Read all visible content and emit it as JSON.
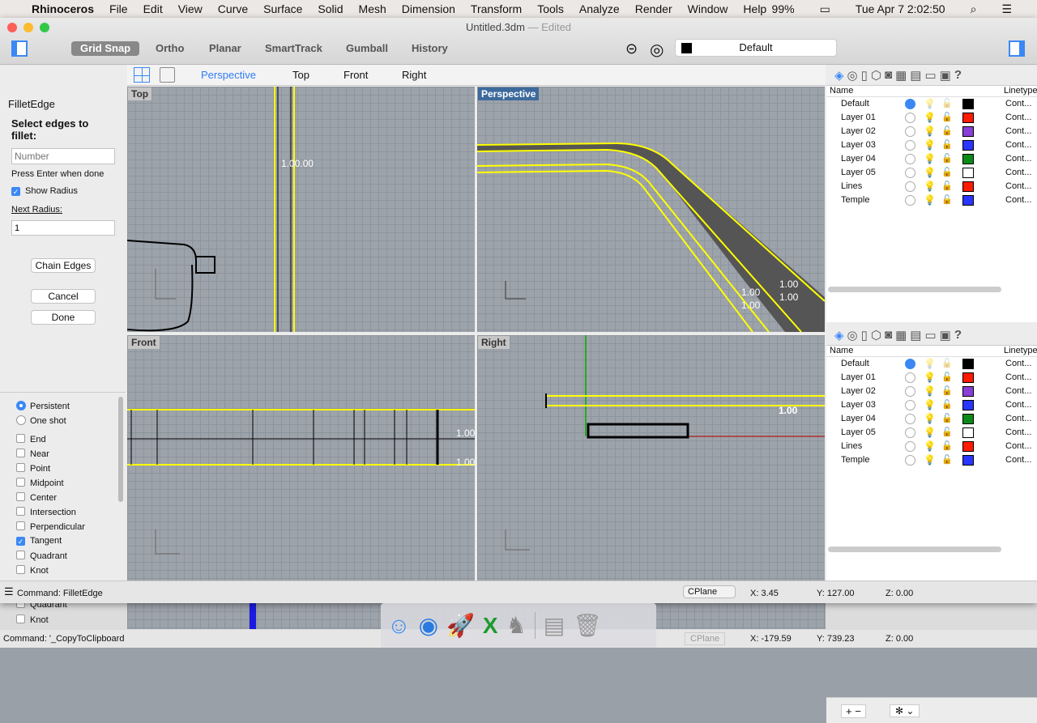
{
  "menubar": {
    "app": "Rhinoceros",
    "items": [
      "File",
      "Edit",
      "View",
      "Curve",
      "Surface",
      "Solid",
      "Mesh",
      "Dimension",
      "Transform",
      "Tools",
      "Analyze",
      "Render",
      "Window",
      "Help"
    ],
    "battery": "99%",
    "clock": "Tue Apr 7  2:02:50"
  },
  "window": {
    "title": "Untitled.3dm",
    "status": "Edited"
  },
  "toolbar": {
    "buttons": [
      "Grid Snap",
      "Ortho",
      "Planar",
      "SmartTrack",
      "Gumball",
      "History"
    ],
    "layer": "Default"
  },
  "viewport_tabs": [
    "Perspective",
    "Top",
    "Front",
    "Right"
  ],
  "viewports": {
    "top": "Top",
    "perspective": "Perspective",
    "front": "Front",
    "right": "Right"
  },
  "dims": {
    "top": "1.00.00",
    "persp": [
      "1.00",
      "1.00",
      "1.00",
      "1.00"
    ],
    "front": [
      "1.00",
      "1.00"
    ],
    "right": "1.00"
  },
  "command_panel": {
    "title": "FilletEdge",
    "prompt": "Select edges to fillet:",
    "number_placeholder": "Number",
    "hint": "Press Enter when done",
    "show_radius": "Show Radius",
    "next_radius_label": "Next Radius:",
    "next_radius": "1",
    "chain": "Chain Edges",
    "cancel": "Cancel",
    "done": "Done"
  },
  "osnap": {
    "modes": [
      "Persistent",
      "One shot"
    ],
    "items": [
      {
        "label": "End",
        "checked": false
      },
      {
        "label": "Near",
        "checked": false
      },
      {
        "label": "Point",
        "checked": false
      },
      {
        "label": "Midpoint",
        "checked": false
      },
      {
        "label": "Center",
        "checked": false
      },
      {
        "label": "Intersection",
        "checked": false
      },
      {
        "label": "Perpendicular",
        "checked": false
      },
      {
        "label": "Tangent",
        "checked": true
      },
      {
        "label": "Quadrant",
        "checked": false
      },
      {
        "label": "Knot",
        "checked": false
      }
    ]
  },
  "layers": {
    "col_name": "Name",
    "col_linetype": "Linetype",
    "rows": [
      {
        "name": "Default",
        "color": "#000000",
        "current": true
      },
      {
        "name": "Layer 01",
        "color": "#ff1a00"
      },
      {
        "name": "Layer 02",
        "color": "#8a3fd6"
      },
      {
        "name": "Layer 03",
        "color": "#2a35ff"
      },
      {
        "name": "Layer 04",
        "color": "#0a8a18"
      },
      {
        "name": "Layer 05",
        "color": "#ffffff"
      },
      {
        "name": "Lines",
        "color": "#ff1a00"
      },
      {
        "name": "Temple",
        "color": "#2a35ff"
      }
    ],
    "linetype": "Cont..."
  },
  "statusbar": {
    "command": "Command: FilletEdge",
    "cplane": "CPlane",
    "x": "X: 3.45",
    "y": "Y: 127.00",
    "z": "Z: 0.00"
  },
  "background": {
    "command": "Command: '_CopyToClipboard",
    "cplane": "CPlane",
    "x": "X: -179.59",
    "y": "Y: 739.23",
    "z": "Z: 0.00",
    "snap_items": [
      "Quadrant",
      "Knot"
    ]
  },
  "dock": [
    "finder-icon",
    "safari-icon",
    "launchpad-icon",
    "excel-icon",
    "rhino-icon",
    "preview-icon",
    "trash-icon"
  ]
}
